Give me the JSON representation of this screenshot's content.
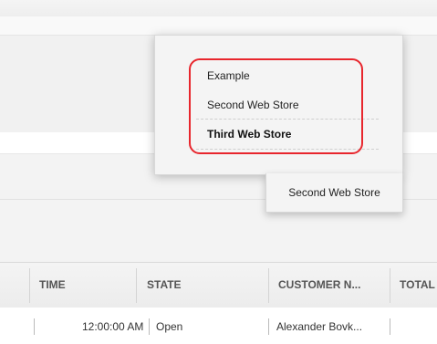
{
  "store_dropdown": {
    "items": [
      {
        "label": "Example"
      },
      {
        "label": "Second Web Store"
      },
      {
        "label": "Third Web Store"
      }
    ],
    "selected_index": 2
  },
  "store_selector": {
    "current_label": "Second Web Store"
  },
  "orders_table": {
    "columns": [
      "TIME",
      "STATE",
      "CUSTOMER N...",
      "TOTAL"
    ],
    "rows": [
      {
        "time": "12:00:00 AM",
        "state": "Open",
        "customer": "Alexander Bovk..."
      }
    ]
  },
  "colors": {
    "highlight": "#e8262d",
    "dropdown_bg": "#f4f4f4"
  }
}
